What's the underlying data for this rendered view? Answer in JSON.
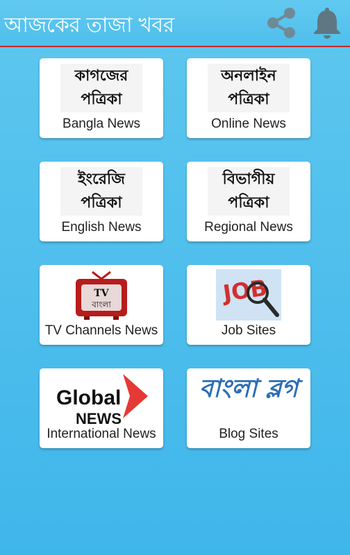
{
  "app": {
    "title": "আজকের তাজা খবর",
    "share_icon": "share-icon",
    "notification_icon": "bell-icon"
  },
  "colors": {
    "background": "#3fb6ea",
    "appbar_divider": "#c62828",
    "card": "#ffffff",
    "blog_logo": "#2c6fb5",
    "tv": "#b71c1c"
  },
  "cards": [
    {
      "line1": "কাগজের",
      "line2": "পত্রিকা",
      "label": "Bangla News"
    },
    {
      "line1": "অনলাইন",
      "line2": "পত্রিকা",
      "label": "Online News"
    },
    {
      "line1": "ইংরেজি",
      "line2": "পত্রিকা",
      "label": "English News"
    },
    {
      "line1": "বিভাগীয়",
      "line2": "পত্রিকা",
      "label": "Regional News"
    },
    {
      "image_icon": "tv-icon",
      "image_text_top": "TV",
      "image_text_bottom": "বাংলা",
      "label": "TV Channels News"
    },
    {
      "image_icon": "job-magnifier-icon",
      "image_text": "JOB",
      "label": "Job Sites"
    },
    {
      "image_icon": "global-news-logo",
      "logo_line1": "Global",
      "logo_line2": "NEWS",
      "label": "International News"
    },
    {
      "image_icon": "bangla-blog-logo",
      "logo_text": "বাংলা ব্লগ",
      "label": "Blog Sites"
    }
  ]
}
